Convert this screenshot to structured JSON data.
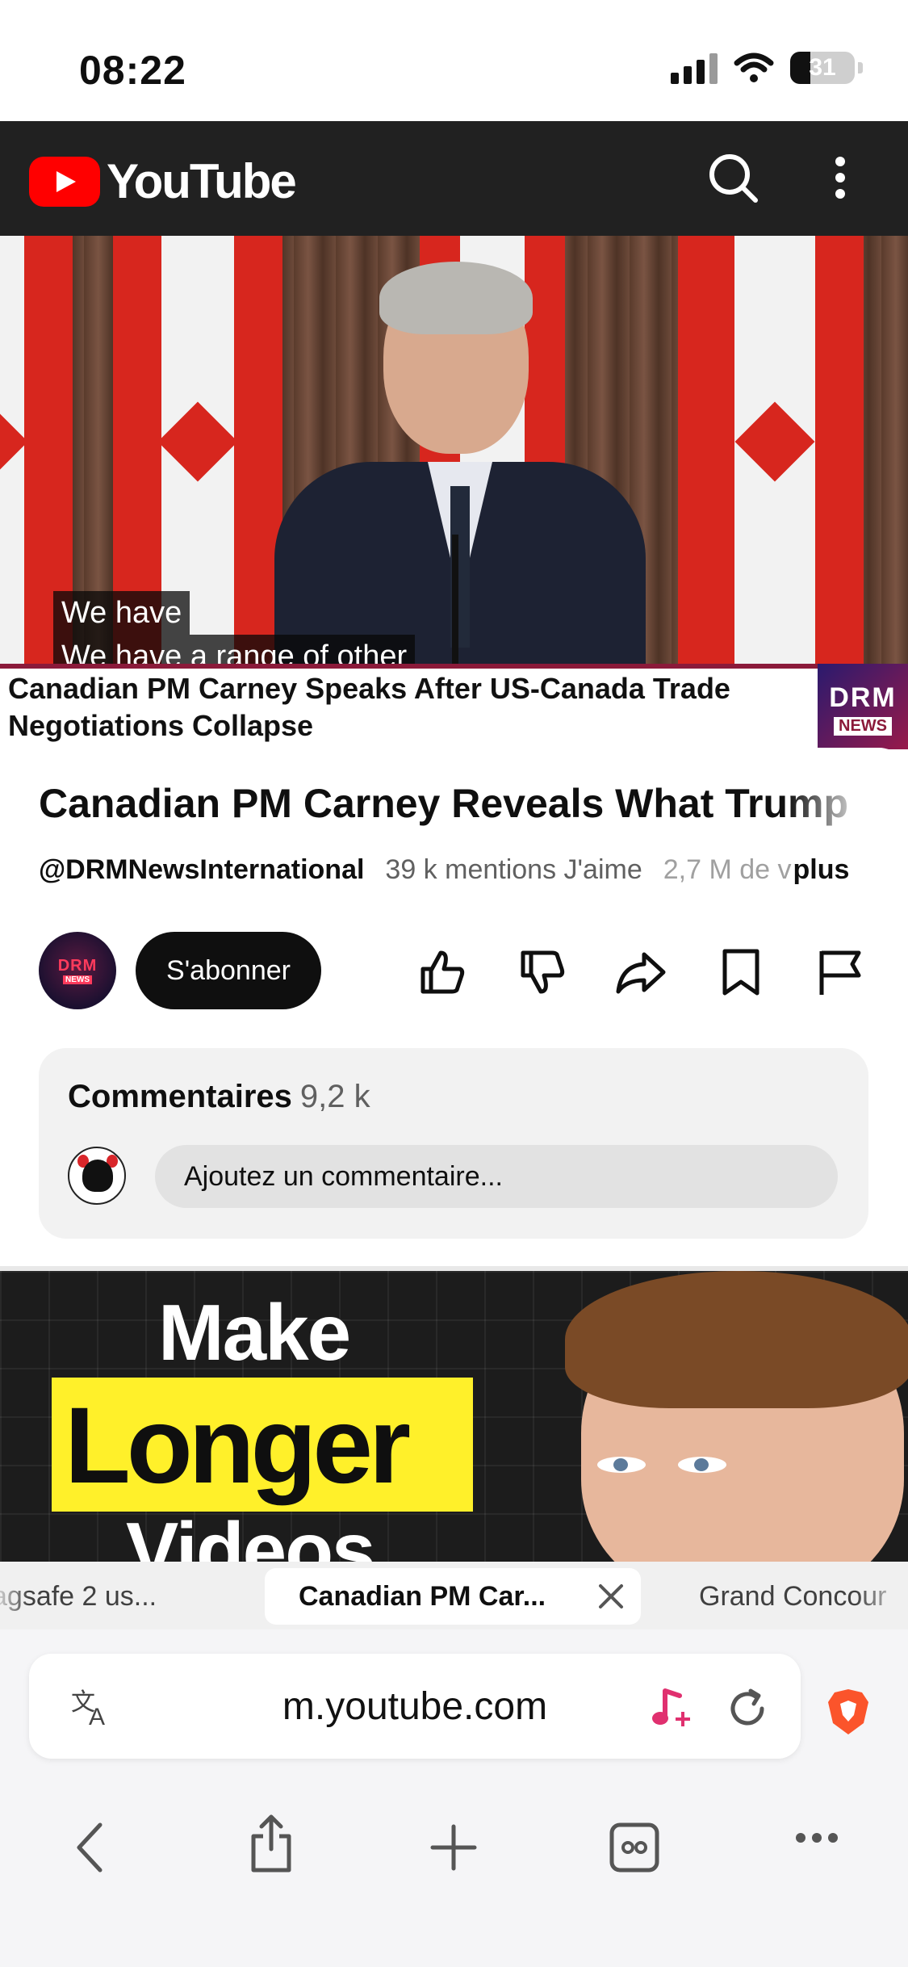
{
  "status_bar": {
    "time": "08:22",
    "battery": "31"
  },
  "youtube": {
    "logo_text": "YouTube"
  },
  "video": {
    "captions": [
      "We have",
      "We have a range of other"
    ],
    "lower_third": "Canadian PM Carney Speaks After US-Canada Trade Negotiations Collapse",
    "badge_top": "DRM",
    "badge_bottom": "NEWS"
  },
  "info": {
    "title": "Canadian PM Carney Reveals What Trump",
    "channel": "@DRMNewsInternational",
    "likes": "39 k mentions J'aime",
    "views": "2,7 M de v",
    "more": "plus",
    "subscribe_label": "S'abonner",
    "avatar_top": "DRM",
    "avatar_bottom": "NEWS"
  },
  "comments": {
    "title": "Commentaires",
    "count": "9,2 k",
    "placeholder": "Ajoutez un commentaire..."
  },
  "next_video": {
    "line1": "Make",
    "line2": "Longer",
    "line3": "Videos"
  },
  "tabs": [
    {
      "label": "agsafe 2 us..."
    },
    {
      "label": "Canadian PM Car..."
    },
    {
      "label": "Grand Concour"
    }
  ],
  "browser": {
    "url": "m.youtube.com"
  },
  "colors": {
    "youtube_red": "#ff0000",
    "topbar": "#212121",
    "brave_orange": "#fb542b"
  }
}
